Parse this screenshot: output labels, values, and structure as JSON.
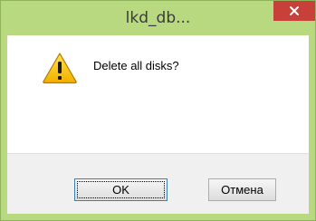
{
  "window": {
    "title": "lkd_db...",
    "close_icon": "close-icon",
    "frame_color": "#b8d97f",
    "close_color": "#c7413a"
  },
  "dialog": {
    "icon": "warning-icon",
    "message": "Delete all disks?"
  },
  "buttons": {
    "ok_label": "OK",
    "cancel_label": "Отмена"
  }
}
